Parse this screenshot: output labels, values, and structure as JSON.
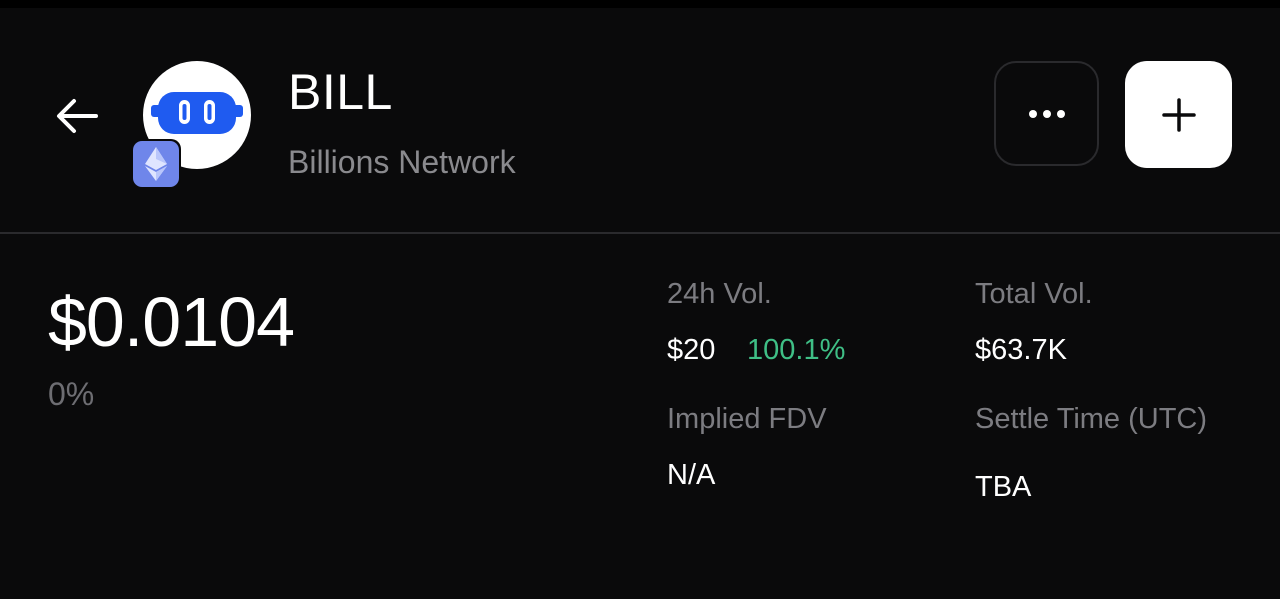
{
  "token": {
    "symbol": "BILL",
    "name": "Billions Network",
    "chain_icon": "ethereum-icon",
    "logo_icon": "billions-robot-logo"
  },
  "header": {
    "back_icon": "arrow-left-icon",
    "more_icon": "ellipsis-icon",
    "add_icon": "plus-icon"
  },
  "price": {
    "value": "$0.0104",
    "change": "0%"
  },
  "stats": {
    "vol24h": {
      "label": "24h Vol.",
      "value": "$20",
      "change": "100.1%"
    },
    "total_vol": {
      "label": "Total Vol.",
      "value": "$63.7K"
    },
    "implied_fdv": {
      "label": "Implied FDV",
      "value": "N/A"
    },
    "settle_time": {
      "label": "Settle Time (UTC)",
      "value": "TBA"
    }
  },
  "colors": {
    "background": "#0a0a0b",
    "positive": "#3fbf86",
    "muted": "#7c7c81",
    "logo_blue": "#1f5bf0",
    "chain_badge": "#6f86ea"
  }
}
